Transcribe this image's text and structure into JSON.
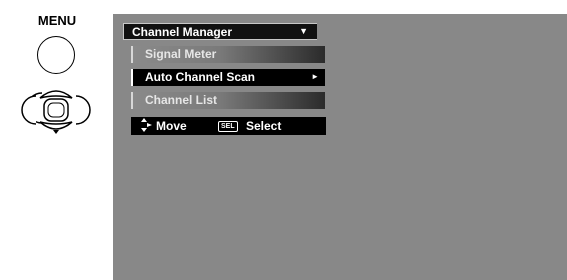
{
  "remote": {
    "menu_label": "MENU",
    "icons": [
      "menu-button-icon",
      "directional-pad-icon"
    ]
  },
  "osd": {
    "dropdown": {
      "label": "Channel Manager",
      "arrow": "▼"
    },
    "items": [
      {
        "label": "Signal Meter",
        "state": "normal"
      },
      {
        "label": "Auto Channel Scan",
        "state": "highlighted",
        "submenu_arrow": "►"
      },
      {
        "label": "Channel List",
        "state": "normal"
      }
    ],
    "help": {
      "move_label": "Move",
      "select_icon": "SEL",
      "select_label": "Select"
    }
  },
  "colors": {
    "screen_bg": "#888888",
    "menu_item_bg": "#000000",
    "text": "#ffffff"
  }
}
